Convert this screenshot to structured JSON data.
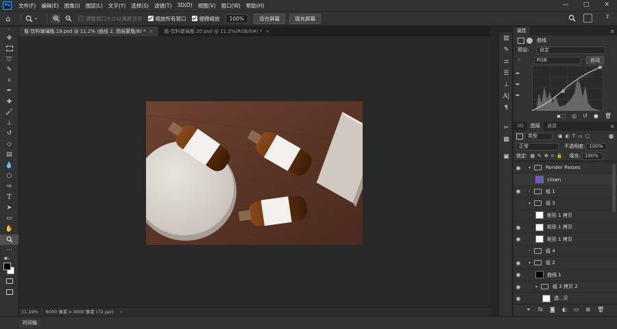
{
  "app": {
    "logo": "Ps"
  },
  "menu": [
    "文件(F)",
    "编辑(E)",
    "图像(I)",
    "图层(L)",
    "文字(Y)",
    "选择(S)",
    "滤镜(T)",
    "3D(D)",
    "视图(V)",
    "窗口(W)",
    "帮助(H)"
  ],
  "window_controls": {
    "minimize": "—",
    "maximize": "□",
    "close": "✕"
  },
  "options": {
    "resize_windows": "调整窗口大小以满屏显示",
    "zoom_all": "缩放所有窗口",
    "scrubby_zoom": "细微缩放",
    "zoom_value": "100%",
    "fit_screen": "适合屏幕",
    "fill_screen": "填充屏幕"
  },
  "tabs": [
    {
      "label": "瓶-饮料玻璃瓶.19.psd @ 11.2% (曲线 2, 图层蒙版/8) *",
      "close": "×"
    },
    {
      "label": "瓶-饮料玻璃瓶.20.psd @ 11.2%(RGB/8#) *",
      "close": "×"
    }
  ],
  "status": {
    "zoom": "11.19%",
    "doc_size": "6000 像素 x 4000 像素 (72 ppi)",
    "arrow": "›"
  },
  "timeline": {
    "label": "时间轴"
  },
  "properties": {
    "tab": "属性",
    "curves_label": "曲线",
    "preset_label": "预设:",
    "preset_value": "自定",
    "channel_value": "RGB",
    "auto_button": "自动"
  },
  "layers_panel": {
    "tabs": [
      "3D",
      "图层",
      "通道"
    ],
    "kind_filter": "类型",
    "blend_mode": "正常",
    "opacity_label": "不透明度:",
    "opacity_value": "100%",
    "lock_label": "锁定:",
    "fill_label": "填充:",
    "fill_value": "100%",
    "layers": [
      {
        "name": "Render Passes",
        "type": "group",
        "visible": true
      },
      {
        "name": "clown",
        "type": "layer",
        "visible": false
      },
      {
        "name": "组 1",
        "type": "group",
        "visible": true
      },
      {
        "name": "组 3",
        "type": "group",
        "visible": false
      },
      {
        "name": "矩形 1 拷贝",
        "type": "shape",
        "visible": false
      },
      {
        "name": "矩形 1 拷贝",
        "type": "shape",
        "visible": true
      },
      {
        "name": "矩形 1 拷贝",
        "type": "shape",
        "visible": true
      },
      {
        "name": "组 4",
        "type": "group",
        "visible": false
      },
      {
        "name": "组 2",
        "type": "group",
        "visible": true
      },
      {
        "name": "曲线 1",
        "type": "adjustment",
        "visible": true
      },
      {
        "name": "组 3 拷贝 2",
        "type": "group",
        "visible": true
      },
      {
        "name": "选...贝",
        "type": "layer",
        "visible": true
      }
    ]
  },
  "colors": {
    "accent": "#31a8ff",
    "bg": "#262626",
    "panel": "#323232"
  }
}
